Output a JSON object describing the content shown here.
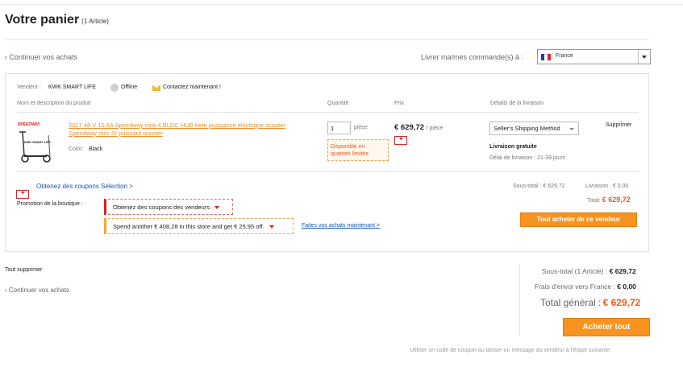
{
  "header": {
    "title": "Votre panier",
    "item_count": "(1 Article)"
  },
  "nav": {
    "continue_shopping": "Continuer vos achats"
  },
  "shipping": {
    "label": "Livrer ma/mes commande(s) à :",
    "country": "France",
    "flag_colors": [
      "#1f3fa6",
      "#ffffff",
      "#d8262c"
    ]
  },
  "seller": {
    "label": "Vendeur :",
    "name": "KWK SMART LIFE",
    "status": "Offline",
    "contact": "Contactez maintenant !"
  },
  "columns": {
    "product": "Nom et description du produit",
    "quantity": "Quantité",
    "price": "Prix",
    "delivery": "Détails de la livraison"
  },
  "product": {
    "title": "2017 48 V 15.6A Speedway mini 4 BLDC HUB forte puissance électrique scooter Speedway mini IV puissant scooter",
    "color_label": "Color:",
    "color_value": "Black",
    "image_logo": "SPEEDWAY",
    "image_caption": "KWK SMART LIFE",
    "quantity": "1",
    "quantity_unit": "pièce",
    "limited_text": "Disponible en quantité limitée",
    "price": "€ 629,72",
    "price_unit": "/ pièce",
    "shipping_method": "Seller's Shipping Method",
    "free_shipping": "Livraison gratuite",
    "delivery_time": "Délai de livraison : 21-39 jours",
    "remove": "Supprimer"
  },
  "promo": {
    "coupons_link": "Obtenez des coupons Sélection >",
    "store_promo_label": "Promotion de la boutique :",
    "seller_coupons": "Obtenez des coupons des vendeurs",
    "spend_offer": "Spend another € 408,28 in this store and get € 25,95 off.",
    "shop_now": "Faites vos achats maintenant",
    "shop_now_arrow": ">"
  },
  "seller_totals": {
    "subtotal": "Sous-total : € 629,72",
    "shipping": "Livraison : € 0,00",
    "total_label": "Total:",
    "total_value": "€ 629,72",
    "buy_seller_button": "Tout acheter de ce vendeur"
  },
  "footer": {
    "delete_all": "Tout supprimer",
    "continue_shopping": "Continuer vos achats",
    "subtotal_label": "Sous-total (1 Article) :",
    "subtotal_value": "€ 629,72",
    "shipping_label": "Frais d'envoi vers France :",
    "shipping_value": "€ 0,00",
    "grand_total_label": "Total général :",
    "grand_total_value": "€ 629,72",
    "buy_all_button": "Acheter tout",
    "note": "Utiliser un code de coupon ou laisser un message au vendeur à l'étape suivante."
  },
  "colors": {
    "accent_orange": "#f7931e",
    "price_orange": "#f05a1a",
    "link_blue": "#1155bb",
    "product_link": "#f08d2c"
  }
}
